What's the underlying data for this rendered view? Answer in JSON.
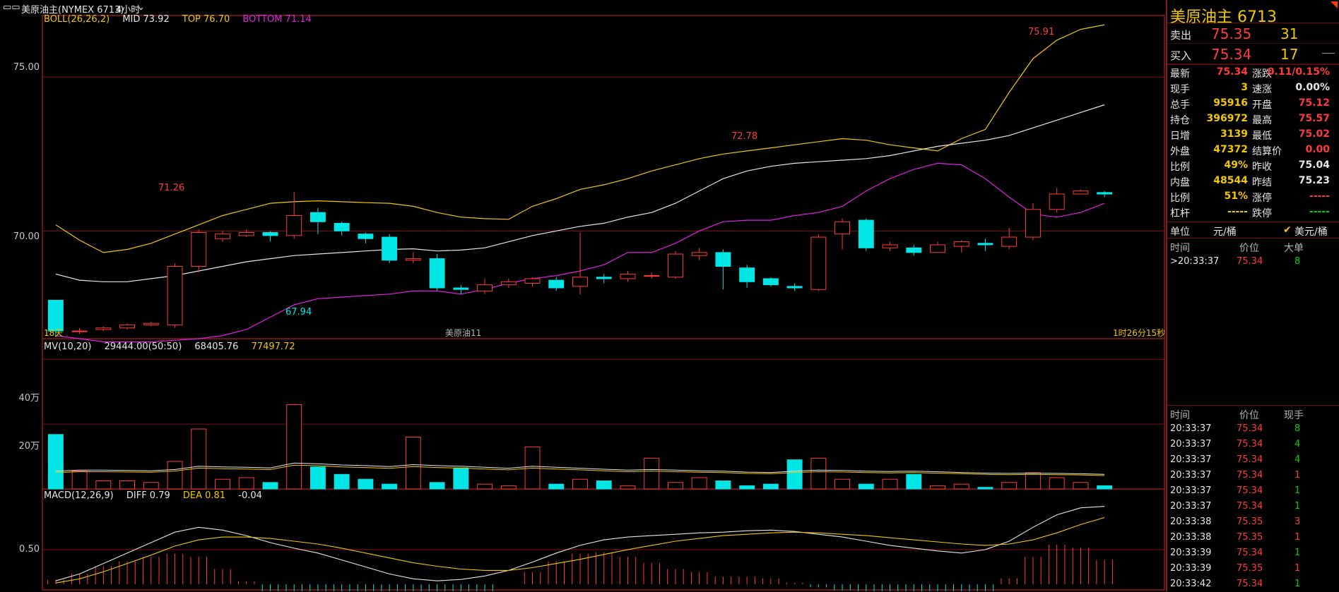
{
  "toolbar": {
    "menu_icon": "menu-icon",
    "instrument_label": "美原油主(NYMEX 6713)",
    "period_label": "4小时",
    "chevron_icon": "chevron-down-icon"
  },
  "colors": {
    "up": "#ff3b3b",
    "down": "#00e5e5",
    "yellow": "#f0c800",
    "white": "#e6e6e6",
    "magenta": "#e020e0",
    "grid": "#7a1414",
    "frame": "#8b1a1a"
  },
  "main_chart": {
    "legend": {
      "name": "BOLL(26,26,2)",
      "mid": "MID 73.92",
      "top": "TOP 76.70",
      "bottom": "BOTTOM 71.14"
    },
    "y_ticks": [
      "75.00",
      "70.00"
    ],
    "annotations": {
      "high_label": "75.91",
      "peak_2": "72.78",
      "peak_1": "71.26",
      "low_label": "67.94"
    },
    "footer": {
      "left": "18天",
      "center": "美原油11",
      "right": "1时26分15秒"
    }
  },
  "volume_chart": {
    "legend": {
      "name": "MV(10,20)",
      "v1": "29444.00(50:50)",
      "v2": "68405.76",
      "v3": "77497.72"
    },
    "y_ticks": [
      "40万",
      "20万"
    ]
  },
  "macd_chart": {
    "legend": {
      "name": "MACD(12,26,9)",
      "diff": "DIFF 0.79",
      "dea": "DEA 0.81",
      "macd": "-0.04"
    },
    "y_ticks": [
      "0.50"
    ]
  },
  "chart_data": [
    {
      "type": "candlestick",
      "title": "",
      "y_range": [
        66.5,
        77.0
      ],
      "bands": {
        "top": [
          70.2,
          69.7,
          69.3,
          69.4,
          69.6,
          69.9,
          70.2,
          70.5,
          70.7,
          70.9,
          70.95,
          70.98,
          70.95,
          70.92,
          70.9,
          70.8,
          70.6,
          70.45,
          70.4,
          70.38,
          70.8,
          71.05,
          71.35,
          71.5,
          71.7,
          71.95,
          72.15,
          72.35,
          72.5,
          72.6,
          72.7,
          72.8,
          72.9,
          73.0,
          72.95,
          72.8,
          72.7,
          72.6,
          73.0,
          73.3,
          74.5,
          75.6,
          76.2,
          76.55,
          76.7
        ],
        "mid": [
          68.6,
          68.4,
          68.35,
          68.35,
          68.45,
          68.55,
          68.7,
          68.85,
          69.0,
          69.1,
          69.2,
          69.25,
          69.3,
          69.35,
          69.4,
          69.42,
          69.35,
          69.38,
          69.45,
          69.65,
          69.85,
          70.0,
          70.15,
          70.25,
          70.45,
          70.6,
          70.9,
          71.3,
          71.7,
          71.95,
          72.1,
          72.2,
          72.25,
          72.3,
          72.35,
          72.45,
          72.6,
          72.75,
          72.85,
          72.95,
          73.1,
          73.35,
          73.6,
          73.85,
          74.1
        ],
        "bottom": [
          66.6,
          66.5,
          66.4,
          66.4,
          66.4,
          66.45,
          66.5,
          66.6,
          66.8,
          67.2,
          67.6,
          67.8,
          67.85,
          67.9,
          67.95,
          68.05,
          68.05,
          67.95,
          68.1,
          68.3,
          68.45,
          68.55,
          68.7,
          68.9,
          69.3,
          69.3,
          69.6,
          70.0,
          70.3,
          70.35,
          70.35,
          70.5,
          70.6,
          70.8,
          71.3,
          71.7,
          72.0,
          72.2,
          72.15,
          71.7,
          71.1,
          70.55,
          70.45,
          70.6,
          70.9
        ]
      },
      "candles": [
        [
          67.75,
          66.75,
          67.75,
          66.55
        ],
        [
          66.75,
          66.75,
          66.85,
          66.65
        ],
        [
          66.8,
          66.85,
          66.9,
          66.75
        ],
        [
          66.85,
          66.95,
          67.0,
          66.8
        ],
        [
          66.95,
          67.0,
          67.05,
          66.9
        ],
        [
          66.95,
          68.85,
          68.95,
          66.85
        ],
        [
          68.85,
          69.95,
          70.05,
          68.65
        ],
        [
          69.75,
          69.9,
          70.0,
          69.65
        ],
        [
          69.85,
          69.95,
          70.05,
          69.8
        ],
        [
          69.95,
          69.85,
          70.0,
          69.65
        ],
        [
          69.85,
          70.5,
          71.26,
          69.75
        ],
        [
          70.6,
          70.3,
          70.75,
          69.9
        ],
        [
          70.25,
          70.0,
          70.3,
          69.85
        ],
        [
          69.9,
          69.75,
          69.95,
          69.6
        ],
        [
          69.8,
          69.05,
          69.9,
          68.95
        ],
        [
          69.05,
          69.1,
          69.3,
          68.95
        ],
        [
          69.1,
          68.15,
          69.25,
          68.05
        ],
        [
          68.15,
          68.1,
          68.25,
          67.95
        ],
        [
          68.05,
          68.25,
          68.45,
          67.95
        ],
        [
          68.25,
          68.35,
          68.45,
          68.15
        ],
        [
          68.3,
          68.45,
          68.5,
          68.2
        ],
        [
          68.4,
          68.15,
          68.5,
          68.05
        ],
        [
          68.2,
          68.5,
          69.95,
          67.94
        ],
        [
          68.5,
          68.45,
          68.6,
          68.3
        ],
        [
          68.45,
          68.6,
          68.7,
          68.35
        ],
        [
          68.55,
          68.55,
          68.65,
          68.45
        ],
        [
          68.5,
          69.25,
          69.35,
          68.45
        ],
        [
          69.2,
          69.3,
          69.45,
          69.05
        ],
        [
          69.3,
          68.85,
          69.4,
          68.1
        ],
        [
          68.8,
          68.35,
          68.9,
          68.15
        ],
        [
          68.45,
          68.25,
          68.5,
          68.2
        ],
        [
          68.2,
          68.15,
          68.3,
          68.05
        ],
        [
          68.1,
          69.8,
          69.9,
          68.05
        ],
        [
          69.9,
          70.3,
          70.4,
          69.4
        ],
        [
          70.35,
          69.45,
          70.4,
          69.35
        ],
        [
          69.45,
          69.55,
          69.65,
          69.35
        ],
        [
          69.45,
          69.3,
          69.55,
          69.2
        ],
        [
          69.3,
          69.55,
          69.65,
          69.3
        ],
        [
          69.5,
          69.65,
          69.7,
          69.3
        ],
        [
          69.6,
          69.55,
          69.75,
          69.35
        ],
        [
          69.5,
          69.8,
          70.1,
          69.4
        ],
        [
          69.8,
          70.7,
          70.9,
          69.7
        ],
        [
          70.7,
          71.2,
          71.4,
          70.6
        ],
        [
          71.2,
          71.3,
          71.35,
          71.2
        ],
        [
          71.25,
          71.2,
          71.3,
          71.1
        ]
      ]
    },
    {
      "type": "bar",
      "title": "",
      "y_range": [
        0,
        420000
      ],
      "values": [
        168000,
        55000,
        25000,
        25000,
        20000,
        85000,
        185000,
        30000,
        35000,
        20000,
        260000,
        68000,
        45000,
        30000,
        15000,
        160000,
        20000,
        65000,
        15000,
        10000,
        130000,
        15000,
        30000,
        25000,
        10000,
        95000,
        20000,
        35000,
        25000,
        10000,
        15000,
        90000,
        95000,
        30000,
        15000,
        30000,
        45000,
        10000,
        15000,
        5000,
        20000,
        50000,
        35000,
        20000,
        10000
      ],
      "colors_by_index": "up/down",
      "ma": {
        "mv10": [
          55000,
          58000,
          58000,
          57000,
          56000,
          60000,
          70000,
          68000,
          67000,
          65000,
          80000,
          78000,
          74000,
          72000,
          69000,
          75000,
          72000,
          70000,
          67000,
          64000,
          70000,
          67000,
          64000,
          61000,
          58000,
          60000,
          58000,
          56000,
          55000,
          52000,
          51000,
          55000,
          58000,
          57000,
          55000,
          54000,
          55000,
          53000,
          51000,
          49000,
          48000,
          49000,
          48000,
          47000,
          45000
        ]
      }
    },
    {
      "type": "line",
      "title": "",
      "y_range": [
        -0.1,
        1.3
      ],
      "series": [
        {
          "values": [
            0.05,
            0.15,
            0.3,
            0.45,
            0.6,
            0.75,
            0.82,
            0.78,
            0.7,
            0.6,
            0.52,
            0.45,
            0.35,
            0.25,
            0.15,
            0.08,
            0.05,
            0.07,
            0.12,
            0.2,
            0.32,
            0.45,
            0.56,
            0.64,
            0.68,
            0.7,
            0.72,
            0.74,
            0.75,
            0.77,
            0.78,
            0.76,
            0.72,
            0.68,
            0.62,
            0.56,
            0.52,
            0.48,
            0.45,
            0.5,
            0.62,
            0.82,
            1.0,
            1.1,
            1.12
          ]
        },
        {
          "values": [
            0.02,
            0.08,
            0.18,
            0.3,
            0.42,
            0.55,
            0.64,
            0.68,
            0.68,
            0.66,
            0.62,
            0.58,
            0.52,
            0.45,
            0.38,
            0.31,
            0.26,
            0.22,
            0.2,
            0.2,
            0.24,
            0.3,
            0.36,
            0.43,
            0.5,
            0.56,
            0.62,
            0.66,
            0.7,
            0.72,
            0.74,
            0.75,
            0.74,
            0.72,
            0.7,
            0.67,
            0.64,
            0.61,
            0.58,
            0.56,
            0.58,
            0.64,
            0.74,
            0.86,
            0.96
          ]
        }
      ],
      "hist": [
        0.03,
        0.07,
        0.12,
        0.15,
        0.18,
        0.2,
        0.18,
        0.1,
        0.02,
        -0.06,
        -0.1,
        -0.13,
        -0.17,
        -0.2,
        -0.23,
        -0.23,
        -0.21,
        -0.15,
        -0.08,
        0.0,
        0.08,
        0.15,
        0.2,
        0.21,
        0.18,
        0.14,
        0.1,
        0.08,
        0.05,
        0.05,
        0.04,
        0.01,
        -0.02,
        -0.04,
        -0.08,
        -0.11,
        -0.12,
        -0.13,
        -0.13,
        -0.06,
        0.04,
        0.18,
        0.26,
        0.24,
        0.16
      ]
    }
  ],
  "panel": {
    "title": "美原油主  6713",
    "ask": {
      "label": "卖出",
      "price": "75.35",
      "vol": "31"
    },
    "bid": {
      "label": "买入",
      "price": "75.34",
      "vol": "17"
    },
    "stats_left": [
      {
        "k": "最新",
        "v": "75.34",
        "c": "#ff3b3b"
      },
      {
        "k": "现手",
        "v": "3",
        "c": "#f0c800"
      },
      {
        "k": "总手",
        "v": "95916",
        "c": "#f0c800"
      },
      {
        "k": "持仓",
        "v": "396972",
        "c": "#f0c800"
      },
      {
        "k": "日增",
        "v": "3139",
        "c": "#f0c800"
      },
      {
        "k": "外盘",
        "v": "47372",
        "c": "#f0c800"
      },
      {
        "k": "比例",
        "v": "49%",
        "c": "#f0c800"
      },
      {
        "k": "内盘",
        "v": "48544",
        "c": "#f0c800"
      },
      {
        "k": "比例",
        "v": "51%",
        "c": "#f0c800"
      },
      {
        "k": "杠杆",
        "v": "-----",
        "c": "#f0c800"
      }
    ],
    "stats_right": [
      {
        "k": "涨跌",
        "v": "0.11/0.15%",
        "c": "#ff3b3b"
      },
      {
        "k": "速涨",
        "v": "0.00%",
        "c": "#e6e6e6"
      },
      {
        "k": "开盘",
        "v": "75.12",
        "c": "#ff3b3b"
      },
      {
        "k": "最高",
        "v": "75.57",
        "c": "#ff3b3b"
      },
      {
        "k": "最低",
        "v": "75.02",
        "c": "#ff3b3b"
      },
      {
        "k": "结算价",
        "v": "0.00",
        "c": "#ff3b3b"
      },
      {
        "k": "昨收",
        "v": "75.04",
        "c": "#e6e6e6"
      },
      {
        "k": "昨结",
        "v": "75.23",
        "c": "#e6e6e6"
      },
      {
        "k": "涨停",
        "v": "-----",
        "c": "#ff3b3b"
      },
      {
        "k": "跌停",
        "v": "-----",
        "c": "#00d000"
      }
    ],
    "unit": {
      "label": "单位",
      "opt1": "元/桶",
      "check_icon": "check-icon",
      "opt2": "美元/桶"
    },
    "big_orders": {
      "headers": {
        "time": "时间",
        "price": "价位",
        "big": "大单"
      },
      "rows": [
        {
          "time": ">20:33:37",
          "price": "75.34",
          "v": "8"
        }
      ]
    },
    "ticks": {
      "headers": {
        "time": "时间",
        "price": "价位",
        "vol": "现手"
      },
      "rows": [
        {
          "time": "20:33:37",
          "price": "75.34",
          "v": "8"
        },
        {
          "time": "20:33:37",
          "price": "75.34",
          "v": "4"
        },
        {
          "time": "20:33:37",
          "price": "75.34",
          "v": "4"
        },
        {
          "time": "20:33:37",
          "price": "75.34",
          "v": "1"
        },
        {
          "time": "20:33:37",
          "price": "75.34",
          "v": "1"
        },
        {
          "time": "20:33:37",
          "price": "75.34",
          "v": "1"
        },
        {
          "time": "20:33:38",
          "price": "75.35",
          "v": "3"
        },
        {
          "time": "20:33:38",
          "price": "75.35",
          "v": "1"
        },
        {
          "time": "20:33:39",
          "price": "75.34",
          "v": "1"
        },
        {
          "time": "20:33:39",
          "price": "75.35",
          "v": "1"
        },
        {
          "time": "20:33:42",
          "price": "75.34",
          "v": "1"
        }
      ]
    }
  }
}
